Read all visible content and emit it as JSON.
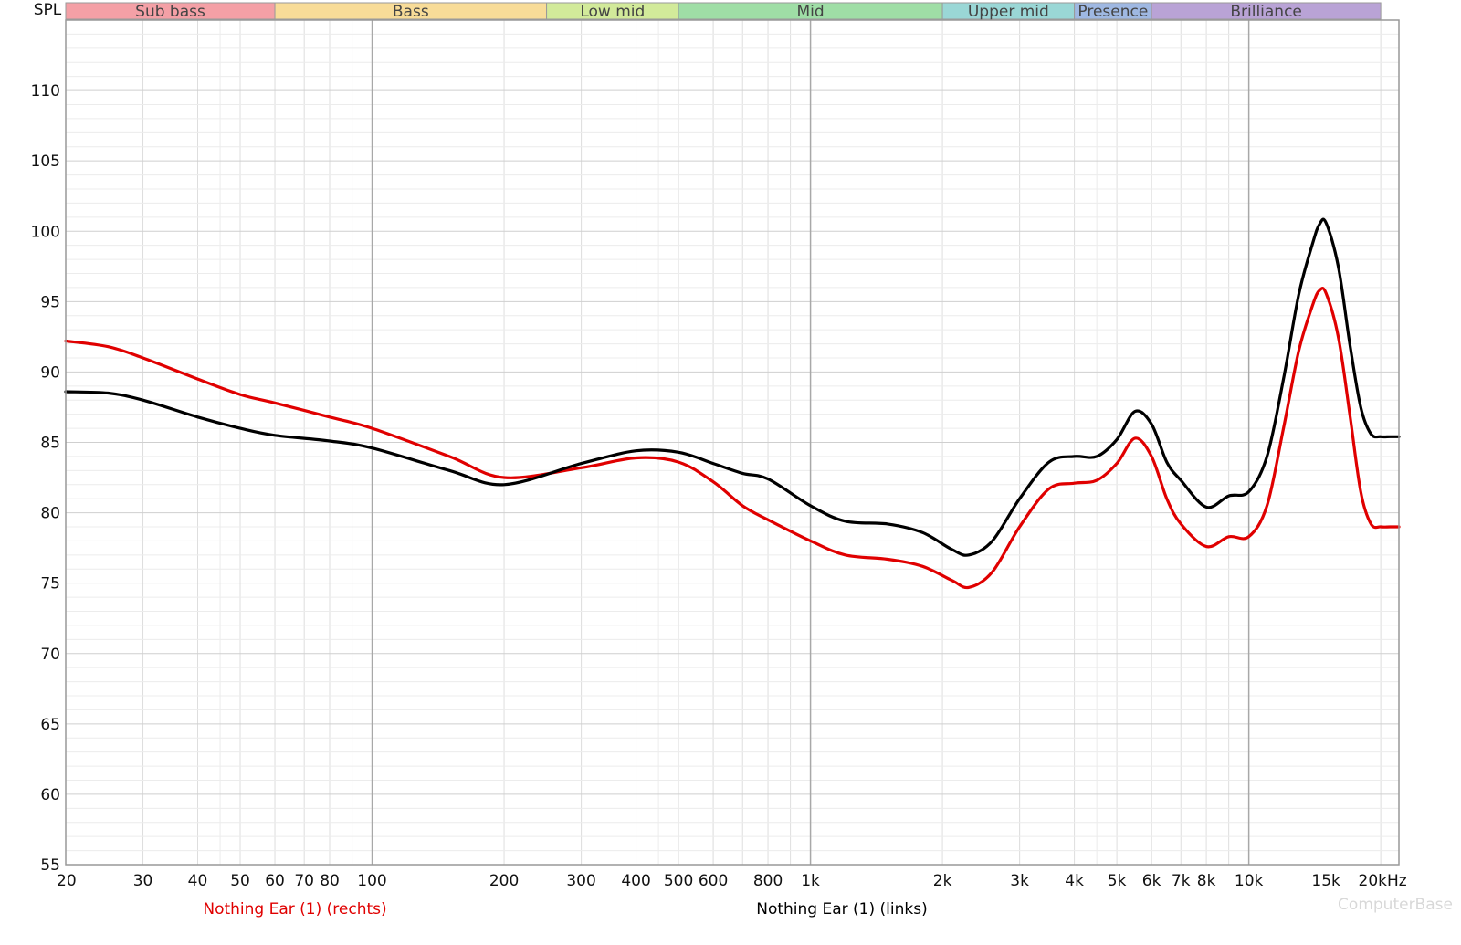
{
  "chart_data": {
    "type": "line",
    "ylabel": "SPL",
    "xscale": "log",
    "xlim": [
      20,
      22000
    ],
    "ylim": [
      55,
      115
    ],
    "grid": true,
    "x_tick_labels": [
      {
        "v": 20,
        "t": "20"
      },
      {
        "v": 30,
        "t": "30"
      },
      {
        "v": 40,
        "t": "40"
      },
      {
        "v": 50,
        "t": "50"
      },
      {
        "v": 60,
        "t": "60"
      },
      {
        "v": 70,
        "t": "70"
      },
      {
        "v": 80,
        "t": "80"
      },
      {
        "v": 100,
        "t": "100"
      },
      {
        "v": 200,
        "t": "200"
      },
      {
        "v": 300,
        "t": "300"
      },
      {
        "v": 400,
        "t": "400"
      },
      {
        "v": 500,
        "t": "500"
      },
      {
        "v": 600,
        "t": "600"
      },
      {
        "v": 800,
        "t": "800"
      },
      {
        "v": 1000,
        "t": "1k"
      },
      {
        "v": 2000,
        "t": "2k"
      },
      {
        "v": 3000,
        "t": "3k"
      },
      {
        "v": 4000,
        "t": "4k"
      },
      {
        "v": 5000,
        "t": "5k"
      },
      {
        "v": 6000,
        "t": "6k"
      },
      {
        "v": 7000,
        "t": "7k"
      },
      {
        "v": 8000,
        "t": "8k"
      },
      {
        "v": 10000,
        "t": "10k"
      },
      {
        "v": 15000,
        "t": "15k"
      },
      {
        "v": 20000,
        "t": "20kHz"
      }
    ],
    "y_ticks": [
      55,
      60,
      65,
      70,
      75,
      80,
      85,
      90,
      95,
      100,
      105,
      110
    ],
    "bands": [
      {
        "label": "Sub bass",
        "from": 20,
        "to": 60,
        "color": "#f4a0a6"
      },
      {
        "label": "Bass",
        "from": 60,
        "to": 250,
        "color": "#f8dc98"
      },
      {
        "label": "Low mid",
        "from": 250,
        "to": 500,
        "color": "#d2ea9a"
      },
      {
        "label": "Mid",
        "from": 500,
        "to": 2000,
        "color": "#9fdea6"
      },
      {
        "label": "Upper mid",
        "from": 2000,
        "to": 4000,
        "color": "#9ad7d6"
      },
      {
        "label": "Presence",
        "from": 4000,
        "to": 6000,
        "color": "#9fb8e2"
      },
      {
        "label": "Brilliance",
        "from": 6000,
        "to": 20000,
        "color": "#b9a3d6"
      }
    ],
    "series": [
      {
        "name": "Nothing Ear (1) (rechts)",
        "color": "#e00000",
        "x": [
          20,
          25,
          30,
          40,
          50,
          60,
          80,
          100,
          150,
          200,
          300,
          400,
          500,
          600,
          700,
          800,
          1000,
          1200,
          1500,
          1800,
          2100,
          2300,
          2600,
          3000,
          3500,
          4000,
          4500,
          5000,
          5500,
          6000,
          6500,
          7000,
          8000,
          9000,
          10000,
          11000,
          12000,
          13000,
          14000,
          14500,
          15000,
          16000,
          17000,
          18000,
          19000,
          20000,
          21000,
          22000
        ],
        "y": [
          92.2,
          91.8,
          91.0,
          89.5,
          88.4,
          87.8,
          86.8,
          86.0,
          84.0,
          82.5,
          83.2,
          83.9,
          83.6,
          82.2,
          80.5,
          79.5,
          78.0,
          77.0,
          76.7,
          76.2,
          75.2,
          74.7,
          75.8,
          79.0,
          81.7,
          82.1,
          82.3,
          83.5,
          85.3,
          84.0,
          81.0,
          79.2,
          77.6,
          78.3,
          78.3,
          80.5,
          86.0,
          91.5,
          94.8,
          95.8,
          95.6,
          92.5,
          87.0,
          81.5,
          79.2,
          79.0,
          79.0,
          79.0
        ]
      },
      {
        "name": "Nothing Ear (1) (links)",
        "color": "#000000",
        "x": [
          20,
          25,
          30,
          40,
          50,
          60,
          80,
          100,
          150,
          200,
          300,
          400,
          500,
          600,
          700,
          800,
          1000,
          1200,
          1500,
          1800,
          2100,
          2300,
          2600,
          3000,
          3500,
          4000,
          4500,
          5000,
          5500,
          6000,
          6500,
          7000,
          8000,
          9000,
          10000,
          11000,
          12000,
          13000,
          14000,
          14500,
          15000,
          16000,
          17000,
          18000,
          19000,
          20000,
          21000,
          22000
        ],
        "y": [
          88.6,
          88.5,
          88.0,
          86.8,
          86.0,
          85.5,
          85.1,
          84.6,
          83.0,
          82.0,
          83.5,
          84.4,
          84.3,
          83.5,
          82.8,
          82.4,
          80.5,
          79.4,
          79.2,
          78.6,
          77.4,
          77.0,
          78.0,
          81.0,
          83.6,
          84.0,
          84.0,
          85.2,
          87.2,
          86.3,
          83.6,
          82.3,
          80.4,
          81.2,
          81.5,
          84.0,
          89.5,
          95.5,
          99.2,
          100.5,
          100.6,
          97.5,
          92.0,
          87.5,
          85.6,
          85.4,
          85.4,
          85.4
        ]
      }
    ],
    "legend": [
      {
        "name": "Nothing Ear (1) (rechts)",
        "color": "#e00000"
      },
      {
        "name": "Nothing Ear (1) (links)",
        "color": "#000000"
      }
    ]
  },
  "watermark": "ComputerBase"
}
